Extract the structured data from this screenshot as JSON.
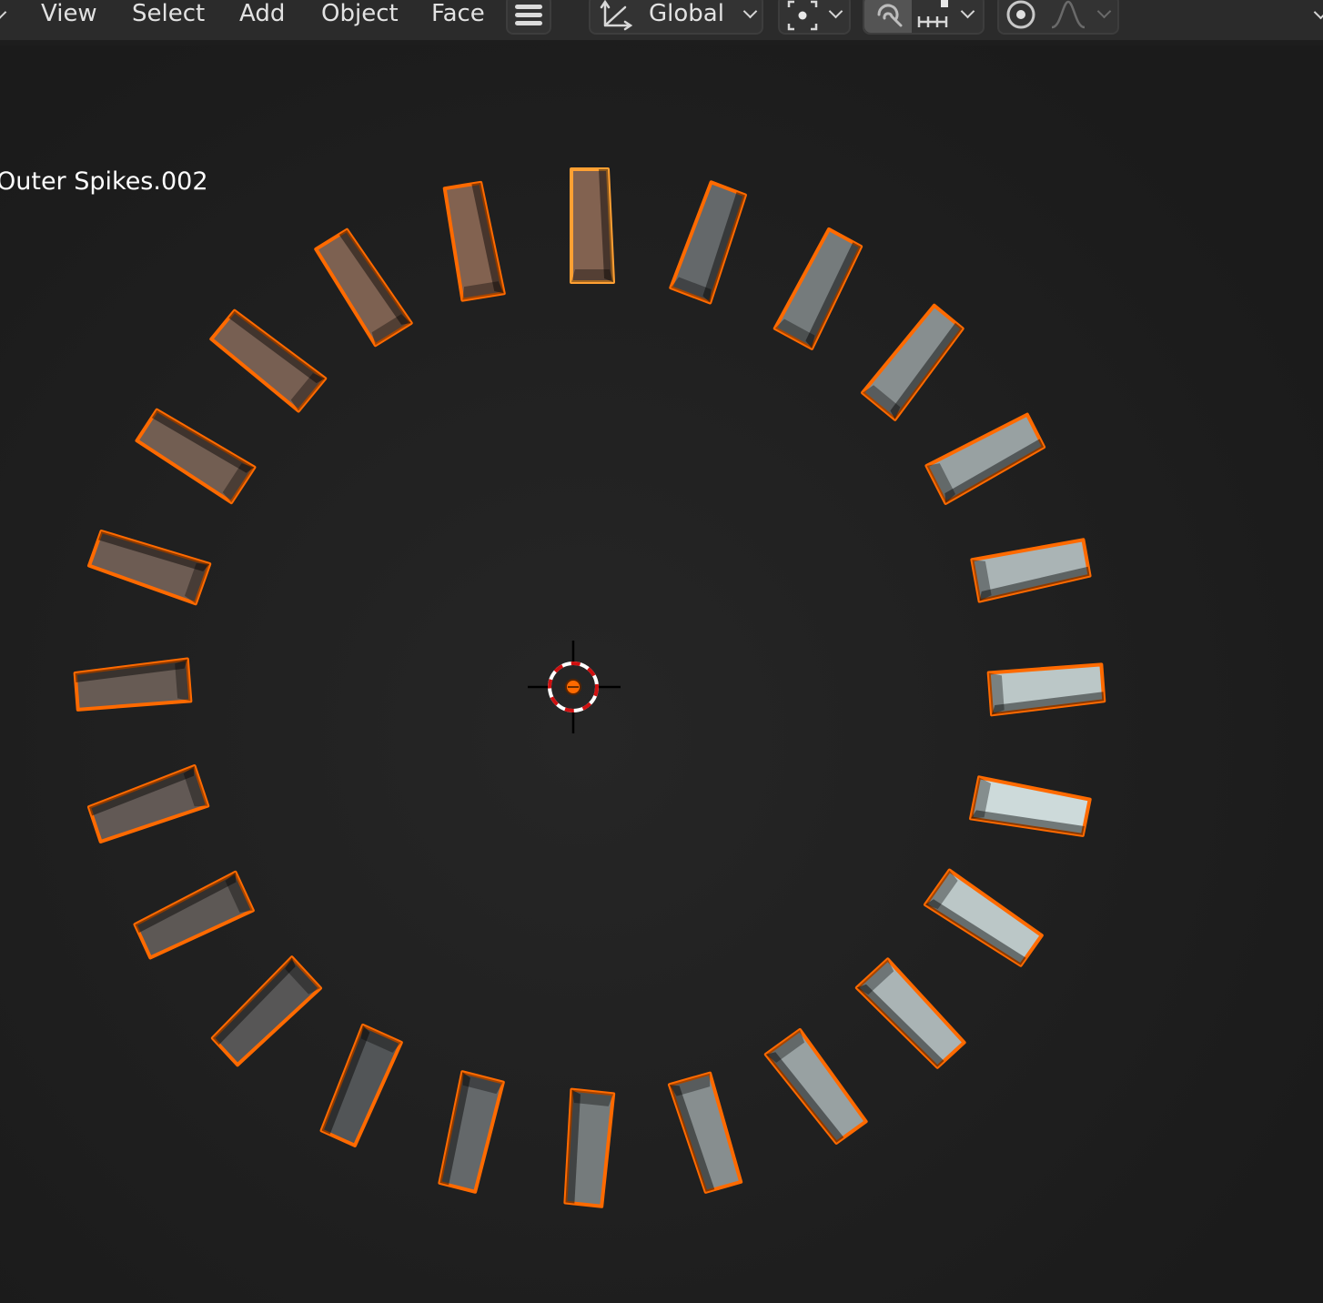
{
  "menu": {
    "items": [
      {
        "label": "View"
      },
      {
        "label": "Select"
      },
      {
        "label": "Add"
      },
      {
        "label": "Object"
      },
      {
        "label": "Face"
      }
    ]
  },
  "toolbar": {
    "transform_orientation": {
      "value": "Global",
      "icon": "transform-axes-icon"
    },
    "pivot_point": {
      "icon": "pivot-point-icon"
    },
    "snapping": {
      "icon": "magnet-icon",
      "enabled": true
    },
    "snap_target": {
      "icon": "snap-increment-icon"
    },
    "proportional_editing": {
      "icon": "proportional-editing-icon"
    },
    "falloff": {
      "icon": "falloff-curve-icon"
    }
  },
  "viewport": {
    "object_name": "Outer Spikes.002",
    "selection_color": "#ff6a00",
    "active_color": "#ffa033",
    "cursor_icon": "3d-cursor-icon",
    "spike_count": 24
  }
}
